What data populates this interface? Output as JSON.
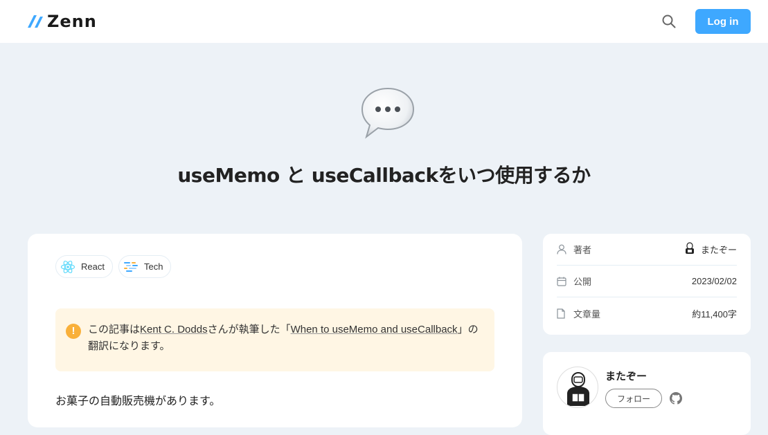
{
  "header": {
    "logo_text": "Zenn",
    "login_label": "Log in",
    "accent": "#3ea8ff"
  },
  "article": {
    "emoji": "speech-bubble-icon",
    "title": "useMemo と useCallbackをいつ使用するか",
    "topics": [
      {
        "label": "React",
        "icon": "react-icon"
      },
      {
        "label": "Tech",
        "icon": "tech-icon"
      }
    ],
    "notice": {
      "prefix": "この記事は",
      "author_link": "Kent C. Dodds",
      "middle": "さんが執筆した「",
      "source_link": "When to useMemo and useCallback",
      "suffix": "」の翻訳になります。"
    },
    "body_first_line": "お菓子の自動販売機があります。"
  },
  "sidebar": {
    "info": [
      {
        "label": "著者",
        "value": "またぞー",
        "icon": "user-icon"
      },
      {
        "label": "公開",
        "value": "2023/02/02",
        "icon": "calendar-icon"
      },
      {
        "label": "文章量",
        "value": "約11,400字",
        "icon": "document-icon"
      }
    ],
    "author": {
      "name": "またぞー",
      "follow_label": "フォロー"
    }
  }
}
